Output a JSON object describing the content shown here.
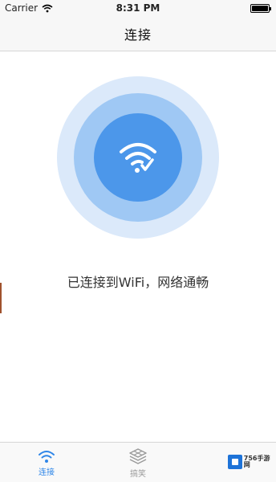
{
  "status_bar": {
    "carrier": "Carrier",
    "time": "8:31 PM"
  },
  "nav": {
    "title": "连接"
  },
  "main": {
    "status_text": "已连接到WiFi，网络通畅",
    "icon": "wifi-check-icon"
  },
  "tabs": [
    {
      "label": "连接",
      "icon": "wifi-icon",
      "active": true
    },
    {
      "label": "搞笑",
      "icon": "stack-icon",
      "active": false
    }
  ],
  "watermark": {
    "brand": "756手游网"
  },
  "colors": {
    "accent": "#2f86e8",
    "ring_outer": "#dbe9fa",
    "ring_mid": "#9fc8f4",
    "ring_inner": "#4c97ea"
  }
}
